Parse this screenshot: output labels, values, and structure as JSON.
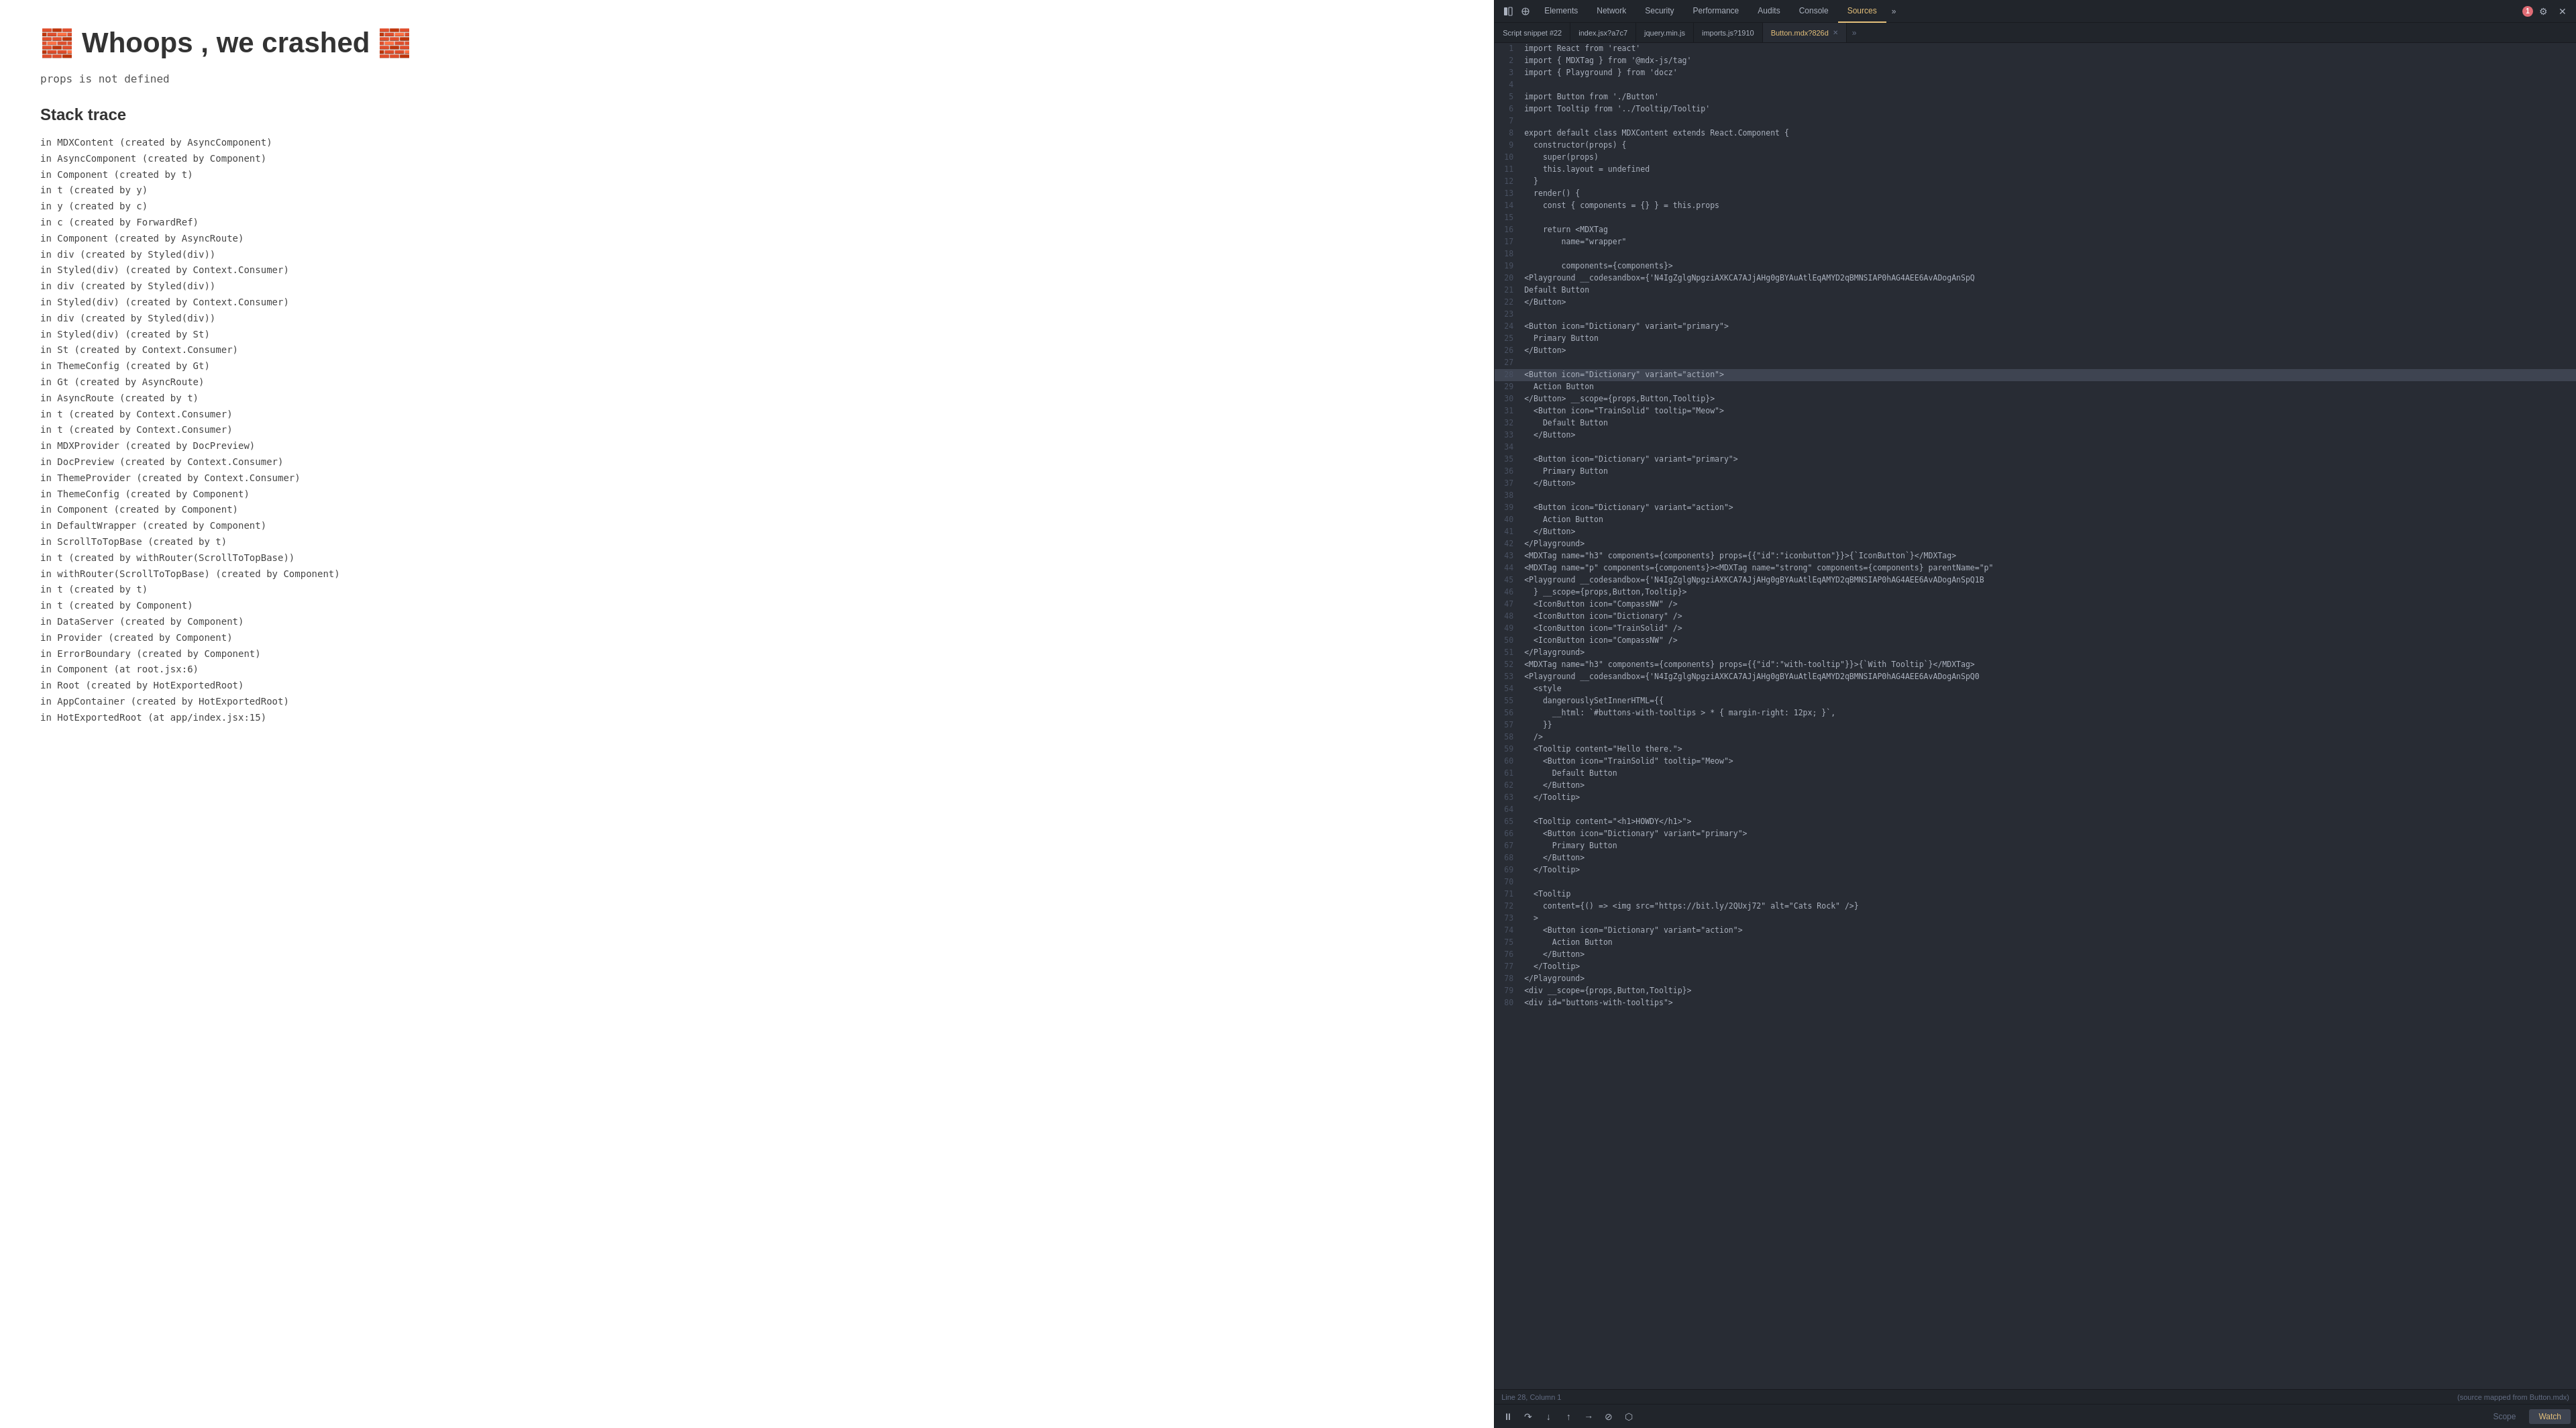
{
  "left": {
    "crash_icon_left": "🧱",
    "crash_icon_right": "🧱",
    "crash_title": "Whoops , we crashed",
    "error_message": "props is not defined",
    "stack_trace_title": "Stack trace",
    "stack_lines": [
      "in MDXContent (created by AsyncComponent)",
      "in AsyncComponent (created by Component)",
      "in Component (created by t)",
      "in t (created by y)",
      "in y (created by c)",
      "in c (created by ForwardRef)",
      "in Component (created by AsyncRoute)",
      "in div (created by Styled(div))",
      "in Styled(div) (created by Context.Consumer)",
      "in div (created by Styled(div))",
      "in Styled(div) (created by Context.Consumer)",
      "in div (created by Styled(div))",
      "in Styled(div) (created by St)",
      "in St (created by Context.Consumer)",
      "in ThemeConfig (created by Gt)",
      "in Gt (created by AsyncRoute)",
      "in AsyncRoute (created by t)",
      "in t (created by Context.Consumer)",
      "in t (created by Context.Consumer)",
      "in MDXProvider (created by DocPreview)",
      "in DocPreview (created by Context.Consumer)",
      "in ThemeProvider (created by Context.Consumer)",
      "in ThemeConfig (created by Component)",
      "in Component (created by Component)",
      "in DefaultWrapper (created by Component)",
      "in ScrollToTopBase (created by t)",
      "in t (created by withRouter(ScrollToTopBase))",
      "in withRouter(ScrollToTopBase) (created by Component)",
      "in t (created by t)",
      "in t (created by Component)",
      "in DataServer (created by Component)",
      "in Provider (created by Component)",
      "in ErrorBoundary (created by Component)",
      "in Component (at root.jsx:6)",
      "in Root (created by HotExportedRoot)",
      "in AppContainer (created by HotExportedRoot)",
      "in HotExportedRoot (at app/index.jsx:15)"
    ]
  },
  "devtools": {
    "nav_tabs": [
      {
        "label": "Elements",
        "active": false
      },
      {
        "label": "Network",
        "active": false
      },
      {
        "label": "Security",
        "active": false
      },
      {
        "label": "Performance",
        "active": false
      },
      {
        "label": "Audits",
        "active": false
      },
      {
        "label": "Console",
        "active": false
      },
      {
        "label": "Sources",
        "active": true
      }
    ],
    "nav_more_label": "»",
    "error_count": "1",
    "file_tabs": [
      {
        "label": "Script snippet #22",
        "active": false,
        "closable": false
      },
      {
        "label": "index.jsx?a7c7",
        "active": false,
        "closable": false
      },
      {
        "label": "jquery.min.js",
        "active": false,
        "closable": false
      },
      {
        "label": "imports.js?1910",
        "active": false,
        "closable": false
      },
      {
        "label": "Button.mdx?826d",
        "active": true,
        "closable": true
      }
    ],
    "file_tabs_more": "»",
    "status_bar": {
      "left": "Line 28, Column 1",
      "right": "(source mapped from Button.mdx)"
    },
    "bottom_tabs": [
      {
        "label": "Scope",
        "active": false
      },
      {
        "label": "Watch",
        "active": true
      }
    ],
    "code_lines": [
      {
        "num": 1,
        "content": "import React from 'react'"
      },
      {
        "num": 2,
        "content": "import { MDXTag } from '@mdx-js/tag'"
      },
      {
        "num": 3,
        "content": "import { Playground } from 'docz'"
      },
      {
        "num": 4,
        "content": ""
      },
      {
        "num": 5,
        "content": "import Button from './Button'"
      },
      {
        "num": 6,
        "content": "import Tooltip from '../Tooltip/Tooltip'"
      },
      {
        "num": 7,
        "content": ""
      },
      {
        "num": 8,
        "content": "export default class MDXContent extends React.Component {"
      },
      {
        "num": 9,
        "content": "  constructor(props) {"
      },
      {
        "num": 10,
        "content": "    super(props)"
      },
      {
        "num": 11,
        "content": "    this.layout = undefined"
      },
      {
        "num": 12,
        "content": "  }"
      },
      {
        "num": 13,
        "content": "  render() {"
      },
      {
        "num": 14,
        "content": "    const { components = {} } = this.props"
      },
      {
        "num": 15,
        "content": ""
      },
      {
        "num": 16,
        "content": "    return <MDXTag"
      },
      {
        "num": 17,
        "content": "        name=\"wrapper\""
      },
      {
        "num": 18,
        "content": ""
      },
      {
        "num": 19,
        "content": "        components={components}>"
      },
      {
        "num": 20,
        "content": "<Playground __codesandbox={'N4IgZglgNpgziAXKCA7AJjAHg0gBYAuAtlEqAMYD2qBMNSIAP0hAG4AEE6AvADogAnSpQ"
      },
      {
        "num": 21,
        "content": "Default Button"
      },
      {
        "num": 22,
        "content": "</Button>"
      },
      {
        "num": 23,
        "content": ""
      },
      {
        "num": 24,
        "content": "<Button icon=\"Dictionary\" variant=\"primary\">"
      },
      {
        "num": 25,
        "content": "  Primary Button"
      },
      {
        "num": 26,
        "content": "</Button>"
      },
      {
        "num": 27,
        "content": ""
      },
      {
        "num": 28,
        "content": "<Button icon=\"Dictionary\" variant=\"action\">",
        "highlighted": true
      },
      {
        "num": 29,
        "content": "  Action Button"
      },
      {
        "num": 30,
        "content": "</Button> __scope={props,Button,Tooltip}>"
      },
      {
        "num": 31,
        "content": "  <Button icon=\"TrainSolid\" tooltip=\"Meow\">"
      },
      {
        "num": 32,
        "content": "    Default Button"
      },
      {
        "num": 33,
        "content": "  </Button>"
      },
      {
        "num": 34,
        "content": ""
      },
      {
        "num": 35,
        "content": "  <Button icon=\"Dictionary\" variant=\"primary\">"
      },
      {
        "num": 36,
        "content": "    Primary Button"
      },
      {
        "num": 37,
        "content": "  </Button>"
      },
      {
        "num": 38,
        "content": ""
      },
      {
        "num": 39,
        "content": "  <Button icon=\"Dictionary\" variant=\"action\">"
      },
      {
        "num": 40,
        "content": "    Action Button"
      },
      {
        "num": 41,
        "content": "  </Button>"
      },
      {
        "num": 42,
        "content": "</Playground>"
      },
      {
        "num": 43,
        "content": "<MDXTag name=\"h3\" components={components} props={{\"id\":\"iconbutton\"}}>{`IconButton`}</MDXTag>"
      },
      {
        "num": 44,
        "content": "<MDXTag name=\"p\" components={components}><MDXTag name=\"strong\" components={components} parentName=\"p\""
      },
      {
        "num": 45,
        "content": "<Playground __codesandbox={'N4IgZglgNpgziAXKCA7AJjAHg0gBYAuAtlEqAMYD2qBMNSIAP0hAG4AEE6AvADogAnSpQ1B"
      },
      {
        "num": 46,
        "content": "  } __scope={props,Button,Tooltip}>"
      },
      {
        "num": 47,
        "content": "  <IconButton icon=\"CompassNW\" />"
      },
      {
        "num": 48,
        "content": "  <IconButton icon=\"Dictionary\" />"
      },
      {
        "num": 49,
        "content": "  <IconButton icon=\"TrainSolid\" />"
      },
      {
        "num": 50,
        "content": "  <IconButton icon=\"CompassNW\" />"
      },
      {
        "num": 51,
        "content": "</Playground>"
      },
      {
        "num": 52,
        "content": "<MDXTag name=\"h3\" components={components} props={{\"id\":\"with-tooltip\"}}>{`With Tooltip`}</MDXTag>"
      },
      {
        "num": 53,
        "content": "<Playground __codesandbox={'N4IgZglgNpgziAXKCA7AJjAHg0gBYAuAtlEqAMYD2qBMNSIAP0hAG4AEE6AvADogAnSpQ0"
      },
      {
        "num": 54,
        "content": "  <style"
      },
      {
        "num": 55,
        "content": "    dangerouslySetInnerHTML={{"
      },
      {
        "num": 56,
        "content": "      __html: `#buttons-with-tooltips > * { margin-right: 12px; }`,"
      },
      {
        "num": 57,
        "content": "    }}"
      },
      {
        "num": 58,
        "content": "  />"
      },
      {
        "num": 59,
        "content": "  <Tooltip content=\"Hello there.\">"
      },
      {
        "num": 60,
        "content": "    <Button icon=\"TrainSolid\" tooltip=\"Meow\">"
      },
      {
        "num": 61,
        "content": "      Default Button"
      },
      {
        "num": 62,
        "content": "    </Button>"
      },
      {
        "num": 63,
        "content": "  </Tooltip>"
      },
      {
        "num": 64,
        "content": ""
      },
      {
        "num": 65,
        "content": "  <Tooltip content=\"<h1>HOWDY</h1>\">"
      },
      {
        "num": 66,
        "content": "    <Button icon=\"Dictionary\" variant=\"primary\">"
      },
      {
        "num": 67,
        "content": "      Primary Button"
      },
      {
        "num": 68,
        "content": "    </Button>"
      },
      {
        "num": 69,
        "content": "  </Tooltip>"
      },
      {
        "num": 70,
        "content": ""
      },
      {
        "num": 71,
        "content": "  <Tooltip"
      },
      {
        "num": 72,
        "content": "    content={() => <img src=\"https://bit.ly/2QUxj72\" alt=\"Cats Rock\" />}"
      },
      {
        "num": 73,
        "content": "  >"
      },
      {
        "num": 74,
        "content": "    <Button icon=\"Dictionary\" variant=\"action\">"
      },
      {
        "num": 75,
        "content": "      Action Button"
      },
      {
        "num": 76,
        "content": "    </Button>"
      },
      {
        "num": 77,
        "content": "  </Tooltip>"
      },
      {
        "num": 78,
        "content": "</Playground>"
      },
      {
        "num": 79,
        "content": "<div __scope={props,Button,Tooltip}>"
      },
      {
        "num": 80,
        "content": "<div id=\"buttons-with-tooltips\">"
      }
    ]
  }
}
